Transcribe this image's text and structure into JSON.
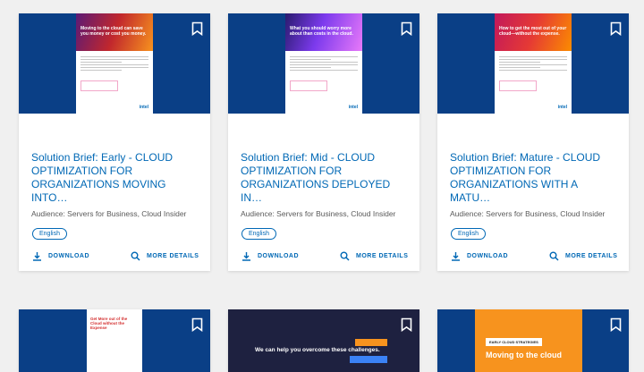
{
  "cards": [
    {
      "title": "Solution Brief: Early - CLOUD OPTIMIZATION FOR ORGANIZATIONS MOVING INTO…",
      "audience": "Audience: Servers for Business, Cloud Insider",
      "language": "English",
      "download_label": "DOWNLOAD",
      "details_label": "MORE DETAILS",
      "thumb_headline": "Moving to the cloud can save you money or cost you money.",
      "thumb_brand": "intel"
    },
    {
      "title": "Solution Brief: Mid - CLOUD OPTIMIZATION FOR ORGANIZATIONS DEPLOYED IN…",
      "audience": "Audience: Servers for Business, Cloud Insider",
      "language": "English",
      "download_label": "DOWNLOAD",
      "details_label": "MORE DETAILS",
      "thumb_headline": "What you should worry more about than costs in the cloud.",
      "thumb_brand": "intel"
    },
    {
      "title": "Solution Brief: Mature - CLOUD OPTIMIZATION FOR ORGANIZATIONS WITH A MATU…",
      "audience": "Audience: Servers for Business, Cloud Insider",
      "language": "English",
      "download_label": "DOWNLOAD",
      "details_label": "MORE DETAILS",
      "thumb_headline": "How to get the most out of your cloud—without the expense.",
      "thumb_brand": "intel"
    }
  ],
  "row2": [
    {
      "thumb_headline": "Get More out of the Cloud without the Expense"
    },
    {
      "thumb_headline": "We can help you overcome these challenges."
    },
    {
      "thumb_tag": "EARLY CLOUD STRATEGIES",
      "thumb_headline": "Moving to the cloud"
    }
  ],
  "colors": {
    "accent": "#0068b5",
    "banner": "#0a3f86",
    "background": "#f0f0f0"
  }
}
